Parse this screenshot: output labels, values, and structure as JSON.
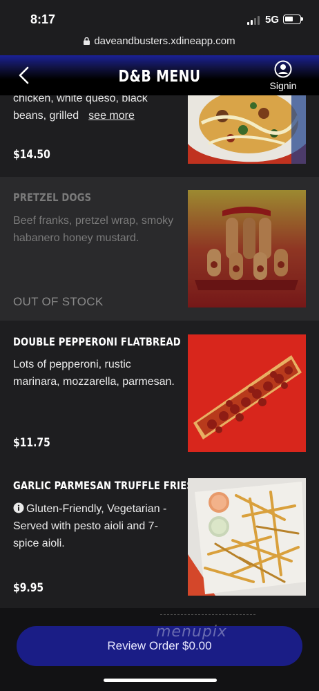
{
  "status_bar": {
    "time": "8:17",
    "network": "5G"
  },
  "browser": {
    "url": "daveandbusters.xdineapp.com"
  },
  "header": {
    "title": "D&B MENU",
    "signin_label": "Signin"
  },
  "menu": {
    "items": [
      {
        "name": "",
        "description_lines": [
          "chicken, white queso, black",
          "beans, grilled"
        ],
        "see_more": "see more",
        "price": "$14.50",
        "image": "nachos-photo"
      },
      {
        "name": "PRETZEL DOGS",
        "description": "Beef franks, pretzel wrap, smoky habanero honey mustard.",
        "status": "OUT OF STOCK",
        "image": "pretzel-dogs-photo"
      },
      {
        "name": "DOUBLE PEPPERONI FLATBREAD",
        "description": "Lots of pepperoni, rustic marinara, mozzarella, parmesan.",
        "price": "$11.75",
        "image": "pepperoni-flatbread-photo"
      },
      {
        "name": "GARLIC PARMESAN TRUFFLE FRIES",
        "description": "Gluten-Friendly, Vegetarian - Served with pesto aioli and 7-spice aioli.",
        "price": "$9.95",
        "image": "truffle-fries-photo",
        "icon": "info-icon"
      }
    ]
  },
  "footer": {
    "review_order_label": "Review Order $0.00",
    "watermark": "menupix"
  },
  "colors": {
    "accent": "#1a1d86",
    "background": "#1b1b1d",
    "muted": "#7a7a7a"
  }
}
